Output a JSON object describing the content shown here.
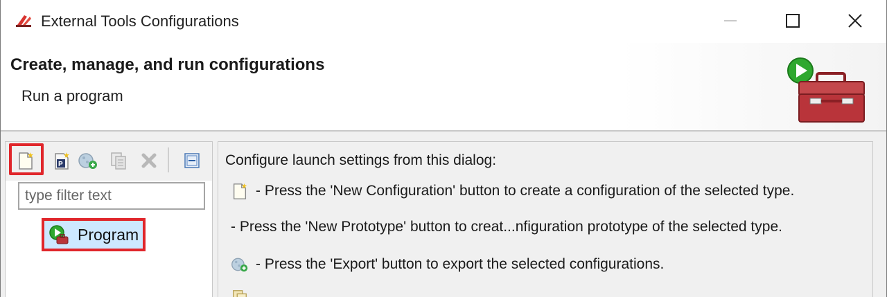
{
  "window": {
    "title": "External Tools Configurations",
    "app_icon": "eclipse-tool-icon"
  },
  "header": {
    "title": "Create, manage, and run configurations",
    "subtitle": "Run a program",
    "icon": "toolbox-run-icon"
  },
  "toolbar": {
    "buttons": [
      {
        "icon": "new-configuration-icon",
        "highlighted": true
      },
      {
        "icon": "new-prototype-icon"
      },
      {
        "icon": "export-icon"
      },
      {
        "icon": "duplicate-icon"
      },
      {
        "icon": "delete-icon"
      },
      {
        "icon": "collapse-all-icon"
      }
    ]
  },
  "filter": {
    "placeholder": "type filter text",
    "value": ""
  },
  "tree": {
    "items": [
      {
        "label": "Program",
        "icon": "program-icon",
        "selected": true
      }
    ]
  },
  "info": {
    "heading": "Configure launch settings from this dialog:",
    "lines": [
      "- Press the 'New Configuration' button to create a configuration of the selected type.",
      "- Press the 'New Prototype' button to creat...nfiguration prototype of the selected type.",
      "- Press the 'Export' button to export the selected configurations."
    ]
  },
  "colors": {
    "highlight": "#e0262b",
    "selection": "#cde8ff",
    "play_green": "#2fa82f",
    "toolbox_red": "#b9343a"
  }
}
